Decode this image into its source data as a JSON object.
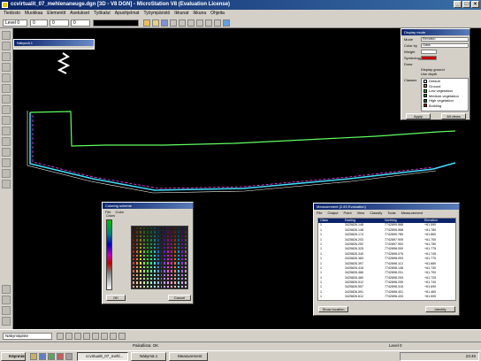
{
  "window": {
    "title": "ccvirtualit_07_mehlenaneuge.dgn [3D - V8 DGN] - MicroStation V8 (Evaluation License)"
  },
  "menu": [
    "Tiedosto",
    "Muokkaa",
    "Elementit",
    "Asetukset",
    "Työkalut",
    "Apuohjelmat",
    "Työympäristö",
    "Ikkunat",
    "Ikkuna",
    "Ohjeita"
  ],
  "toolbar": {
    "active_level": "Level 0",
    "color": "0",
    "style": "0",
    "weight": "0"
  },
  "view_window": {
    "title": "Näkymä 1"
  },
  "display_panel": {
    "title": "Display mode",
    "labels": [
      "Mode",
      "Color by",
      "Weight",
      "Symbology",
      "Draw"
    ],
    "mode_value": "Elevation",
    "colorby_value": "Class",
    "checkboxes": [
      "Display ground",
      "Use depth"
    ],
    "classes_label": "Classes",
    "classes": [
      {
        "name": "Default",
        "color": "#ffffff"
      },
      {
        "name": "Ground",
        "color": "#c08040"
      },
      {
        "name": "Low vegetation",
        "color": "#00c000"
      },
      {
        "name": "Medium vegetation",
        "color": "#00a000"
      },
      {
        "name": "High vegetation",
        "color": "#008000"
      },
      {
        "name": "Building",
        "color": "#c00000"
      },
      {
        "name": "Low point",
        "color": "#ff00ff"
      },
      {
        "name": "Model keypoints",
        "color": "#0000ff"
      }
    ],
    "apply_button": "Apply",
    "all_views_button": "All views"
  },
  "coloring_panel": {
    "title": "Coloring scheme",
    "menu": [
      "File",
      "Color"
    ],
    "ramp_label": "Colors",
    "ok_button": "OK",
    "cancel_button": "Cancel"
  },
  "measure_panel": {
    "title": "Measurement  (2.83 Evaluation)",
    "menu": [
      "File",
      "Output",
      "Point",
      "View",
      "Classify",
      "Tools",
      "Measurement"
    ],
    "columns": [
      "Class",
      "Easting",
      "Northing",
      "Elevation"
    ],
    "rows": [
      [
        "1",
        "3425826.148",
        "7742895.568",
        "+61.590"
      ],
      [
        "1",
        "3425826.148",
        "7742895.568",
        "+61.780"
      ],
      [
        "1",
        "3425826.174",
        "7742895.789",
        "+61.860"
      ],
      [
        "1",
        "3425826.203",
        "7742897.909",
        "+61.700"
      ],
      [
        "1",
        "3425826.252",
        "7742897.992",
        "+61.750"
      ],
      [
        "1",
        "3425826.325",
        "7742898.009",
        "+61.775"
      ],
      [
        "1",
        "3425826.340",
        "7742898.076",
        "+61.745"
      ],
      [
        "1",
        "3425826.383",
        "7742898.093",
        "+61.770"
      ],
      [
        "1",
        "3425826.397",
        "7742898.113",
        "+61.680"
      ],
      [
        "1",
        "3425826.416",
        "7742898.148",
        "+61.730"
      ],
      [
        "1",
        "3425826.466",
        "7742898.201",
        "+61.700"
      ],
      [
        "1",
        "3425826.480",
        "7742898.253",
        "+61.725"
      ],
      [
        "1",
        "3425826.512",
        "7742898.295",
        "+61.740"
      ],
      [
        "1",
        "3425826.557",
        "7742898.315",
        "+61.690"
      ],
      [
        "1",
        "3425826.591",
        "7742898.401",
        "+61.460"
      ],
      [
        "1",
        "3425826.612",
        "7742898.433",
        "+61.590"
      ],
      [
        "1",
        "3425826.648",
        "7742898.478",
        "+61.670"
      ],
      [
        "1",
        "3425826.681",
        "7742898.512",
        "+61.540"
      ],
      [
        "1",
        "3425826.705",
        "7742898.547",
        "+61.520"
      ],
      [
        "1",
        "3425826.727",
        "7742898.581",
        "+61.580"
      ],
      [
        "1",
        "3425826.755",
        "7742898.625",
        "+61.550"
      ],
      [
        "1",
        "3425826.788",
        "7742898.673",
        "+61.510"
      ]
    ],
    "show_location_button": "Show location",
    "identify_button": "Identify"
  },
  "status": {
    "left": "Näkymäpiste",
    "center": "Paikallista: OK",
    "level": "Level 0"
  },
  "taskbar": {
    "start": "Käynnistä",
    "items": [
      "ccvirtualit_07_mehl...",
      "Näkymä 1",
      "Measurement"
    ],
    "clock": "23:46"
  },
  "colors": {
    "accent": "#0a246a",
    "canvas": "#000000",
    "outline_cyan": "#40e0ff",
    "outline_green": "#60ff60",
    "outline_magenta": "#ff40ff"
  }
}
